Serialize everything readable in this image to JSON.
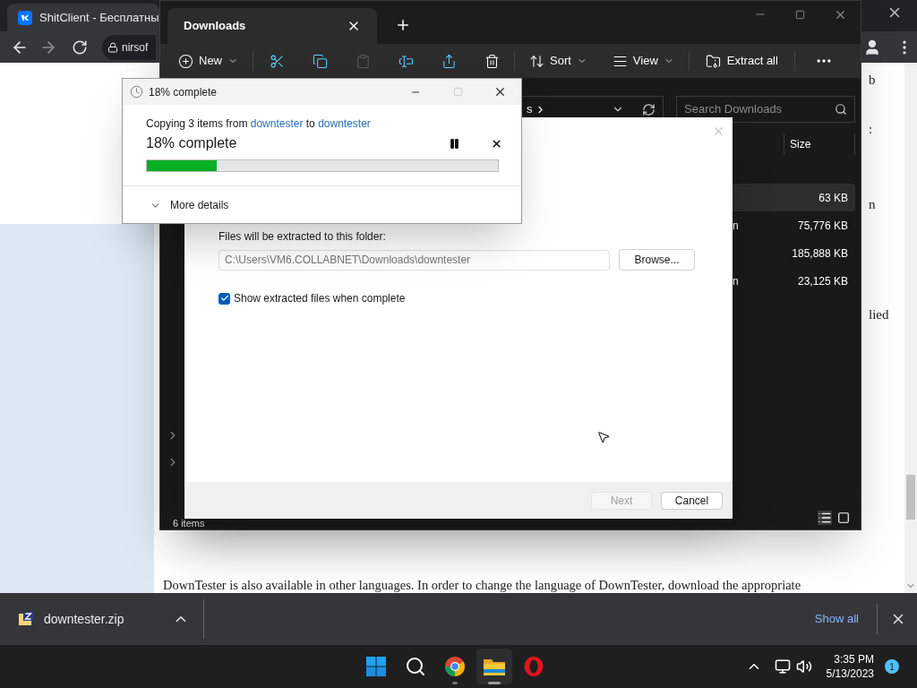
{
  "browser": {
    "tab": {
      "title": "ShitClient - Бесплатны"
    },
    "address": "nirsof",
    "page": {
      "fragments": [
        "b",
        ":",
        "n",
        "lied"
      ],
      "paragraph": "DownTester is also available in other languages. In order to change the language of DownTester, download the appropriate"
    }
  },
  "explorer": {
    "tab": {
      "title": "Downloads"
    },
    "toolbar": {
      "new": "New",
      "sort": "Sort",
      "view": "View",
      "extract": "Extract all"
    },
    "breadcrumb": "s",
    "search": {
      "placeholder": "Search Downloads"
    },
    "columns": [
      "Size"
    ],
    "rows": [
      {
        "size": "63 KB",
        "selected": true
      },
      {
        "type": "n",
        "size": "75,776 KB",
        "selected": false
      },
      {
        "size": "185,888 KB",
        "selected": false
      },
      {
        "type": "n",
        "size": "23,125 KB",
        "selected": false
      }
    ],
    "status": "6 items"
  },
  "extract_dialog": {
    "folder_label": "Files will be extracted to this folder:",
    "path": "C:\\Users\\VM6.COLLABNET\\Downloads\\downtester",
    "browse": "Browse...",
    "show_files": {
      "label": "Show extracted files when complete",
      "checked": true
    },
    "next": {
      "label": "Next",
      "disabled": true
    },
    "cancel": "Cancel"
  },
  "progress_dialog": {
    "title": "18% complete",
    "message": {
      "prefix": "Copying 3 items from",
      "source": "downtester",
      "middle": "to",
      "target": "downtester"
    },
    "heading": "18% complete",
    "level": 0.2,
    "details": "More details"
  },
  "downloads_bar": {
    "file": "downtester.zip",
    "show_all": "Show all"
  },
  "taskbar": {
    "apps": [
      {
        "kind": "start",
        "running": false,
        "selected": false
      },
      {
        "kind": "search",
        "running": false,
        "selected": false
      },
      {
        "kind": "chrome",
        "running": true,
        "selected": false
      },
      {
        "kind": "explorer",
        "running": true,
        "selected": true
      },
      {
        "kind": "opera",
        "running": false,
        "selected": false
      }
    ],
    "time": "3:35 PM",
    "date": "5/13/2023",
    "notifications": "1"
  }
}
